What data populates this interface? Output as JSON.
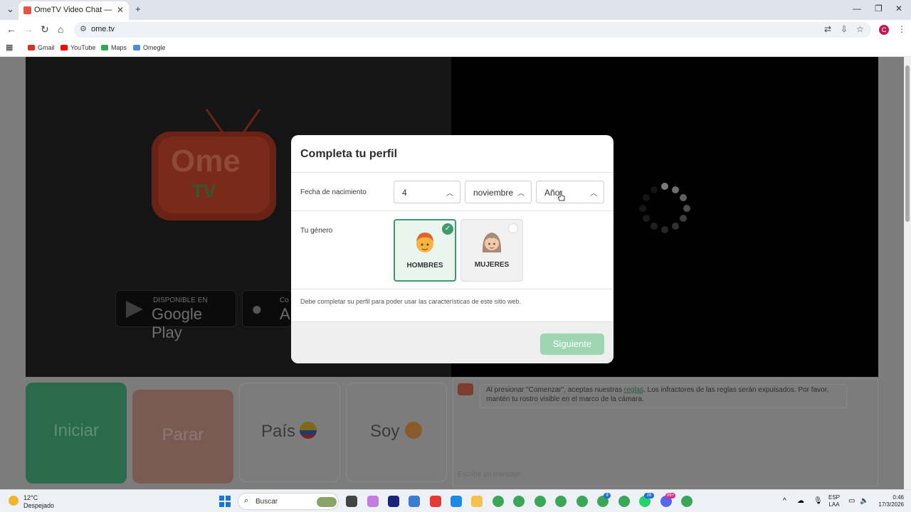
{
  "browser": {
    "tab_title": "OmeTV Video Chat — Omegle",
    "url": "ome.tv",
    "bookmarks": [
      {
        "label": "Gmail",
        "color": "#d93025"
      },
      {
        "label": "YouTube",
        "color": "#ff0000"
      },
      {
        "label": "Maps",
        "color": "#34a853"
      },
      {
        "label": "Omegle",
        "color": "#4a90d9"
      }
    ],
    "profile_initial": "C"
  },
  "page": {
    "logo": {
      "line1": "Ome",
      "line2": "TV"
    },
    "google_play": {
      "small": "DISPONIBLE EN",
      "big": "Google Play"
    },
    "app_store": {
      "small": "Co",
      "big": "A"
    },
    "controls": {
      "start": "Iniciar",
      "stop": "Parar",
      "country": "País",
      "i_am": "Soy"
    },
    "chat": {
      "notice_pre": "Al presionar \"Comenzar\", aceptas nuestras ",
      "notice_link": "reglas",
      "notice_post": ". Los infractores de las reglas serán expulsados. Por favor, mantén tu rostro visible en el marco de la cámara.",
      "input_placeholder": "Escribe un mensaje"
    }
  },
  "modal": {
    "title": "Completa tu perfil",
    "birthdate_label": "Fecha de nacimiento",
    "day": "4",
    "month": "noviembre",
    "year_placeholder": "Año",
    "gender_label": "Tu género",
    "gender_male": "HOMBRES",
    "gender_female": "MUJERES",
    "selected_gender": "HOMBRES",
    "notice": "Debe completar su perfil para poder usar las características de este sitio web.",
    "next_button": "Siguiente",
    "accent": "#3f9b6b"
  },
  "taskbar": {
    "weather_temp": "12°C",
    "weather_desc": "Despejado",
    "search_placeholder": "Buscar",
    "badges": [
      "9",
      "28",
      "99+"
    ],
    "lang_line1": "ESP",
    "lang_line2": "LAA",
    "time": "0:46",
    "date": "17/3/2026"
  }
}
